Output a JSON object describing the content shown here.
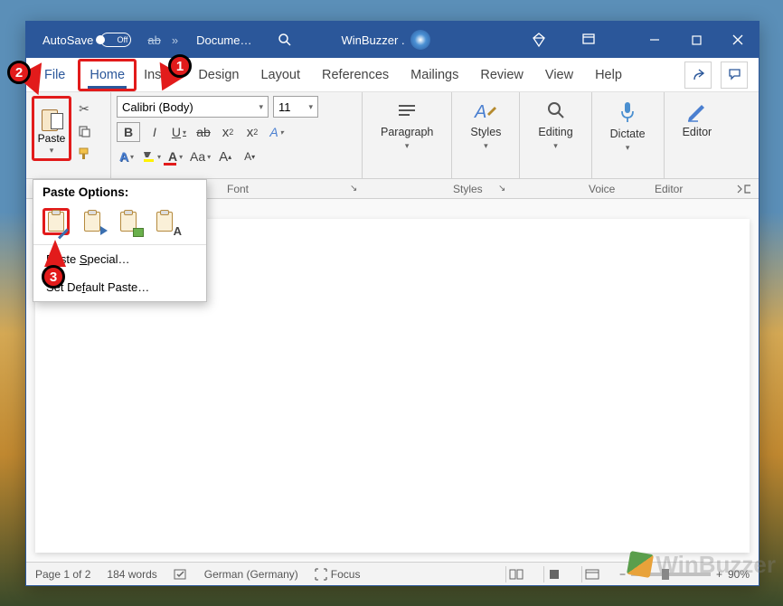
{
  "titlebar": {
    "autosave_label": "AutoSave",
    "autosave_state": "Off",
    "doc_name": "Docume…",
    "app_hint": "WinBuzzer ."
  },
  "tabs": {
    "file": "File",
    "home": "Home",
    "insert": "Insert",
    "design": "Design",
    "layout": "Layout",
    "references": "References",
    "mailings": "Mailings",
    "review": "Review",
    "view": "View",
    "help": "Help"
  },
  "ribbon": {
    "paste_label": "Paste",
    "font_name": "Calibri (Body)",
    "font_size": "11",
    "paragraph": "Paragraph",
    "styles": "Styles",
    "editing": "Editing",
    "dictate": "Dictate",
    "editor": "Editor"
  },
  "group_labels": {
    "font": "Font",
    "styles": "Styles",
    "voice": "Voice",
    "editor": "Editor"
  },
  "paste_menu": {
    "header": "Paste Options:",
    "special": "Paste Special…",
    "special_underline": "S",
    "default": "Set Default Paste…",
    "default_underline": "f"
  },
  "status": {
    "page": "Page 1 of 2",
    "words": "184 words",
    "lang": "German (Germany)",
    "focus": "Focus",
    "zoom": "90%"
  },
  "callouts": {
    "c1": "1",
    "c2": "2",
    "c3": "3"
  },
  "watermark": "WinBuzzer"
}
